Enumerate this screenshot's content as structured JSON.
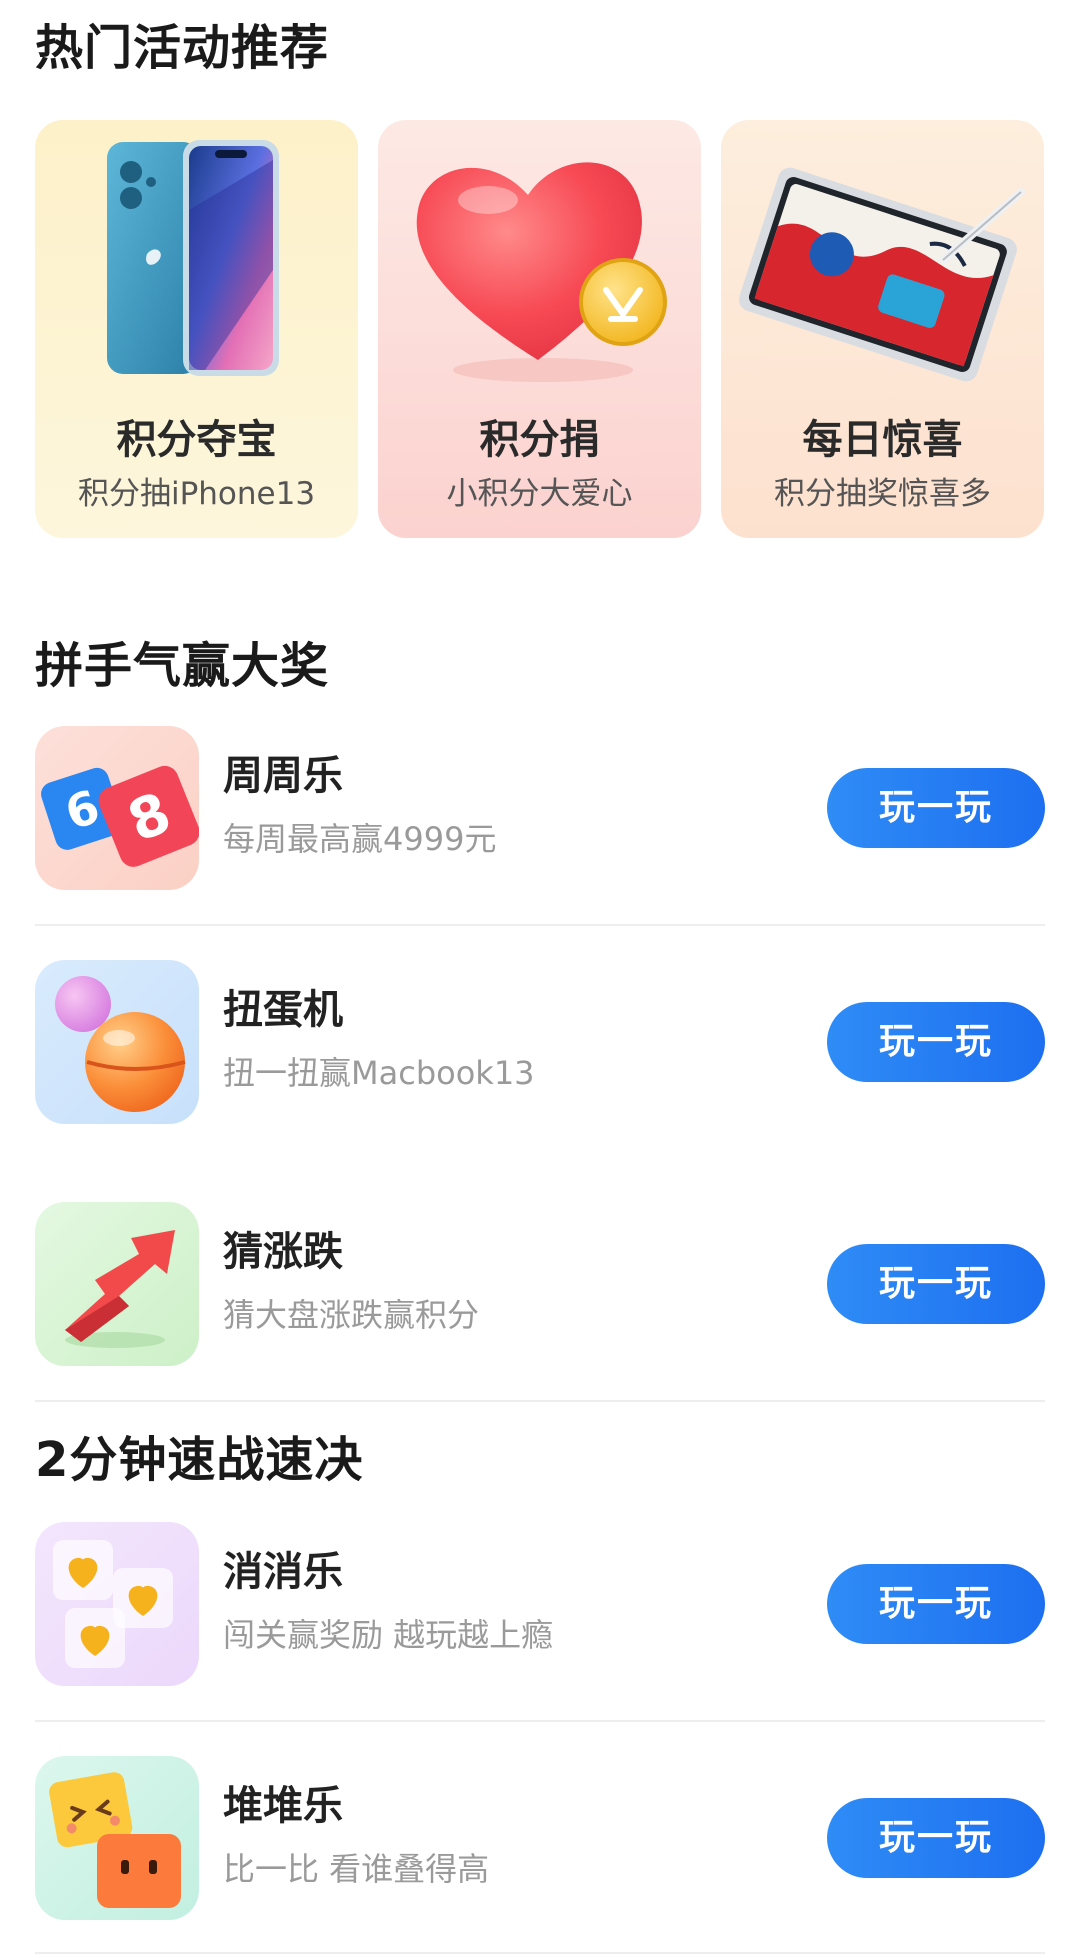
{
  "hot_section": {
    "title": "热门活动推荐",
    "cards": [
      {
        "title": "积分夺宝",
        "subtitle": "积分抽iPhone13",
        "art": "phone-icon"
      },
      {
        "title": "积分捐",
        "subtitle": "小积分大爱心",
        "art": "heart-coin-icon"
      },
      {
        "title": "每日惊喜",
        "subtitle": "积分抽奖惊喜多",
        "art": "tablet-icon"
      }
    ]
  },
  "luck_section": {
    "title": "拼手气赢大奖",
    "games": [
      {
        "name": "周周乐",
        "desc": "每周最高赢4999元",
        "button": "玩一玩",
        "icon": "dice-68-icon"
      },
      {
        "name": "扭蛋机",
        "desc": "扭一扭赢Macbook13",
        "button": "玩一玩",
        "icon": "capsule-ball-icon"
      },
      {
        "name": "猜涨跌",
        "desc": "猜大盘涨跌赢积分",
        "button": "玩一玩",
        "icon": "trend-arrow-icon"
      }
    ]
  },
  "quick_section": {
    "title": "2分钟速战速决",
    "games": [
      {
        "name": "消消乐",
        "desc": "闯关赢奖励 越玩越上瘾",
        "button": "玩一玩",
        "icon": "hearts-cubes-icon"
      },
      {
        "name": "堆堆乐",
        "desc": "比一比 看谁叠得高",
        "button": "玩一玩",
        "icon": "stacked-blocks-icon"
      }
    ]
  },
  "colors": {
    "button": "#2f8cf6",
    "title_text": "#1a1a1a",
    "desc_text": "#9a9a9a"
  }
}
